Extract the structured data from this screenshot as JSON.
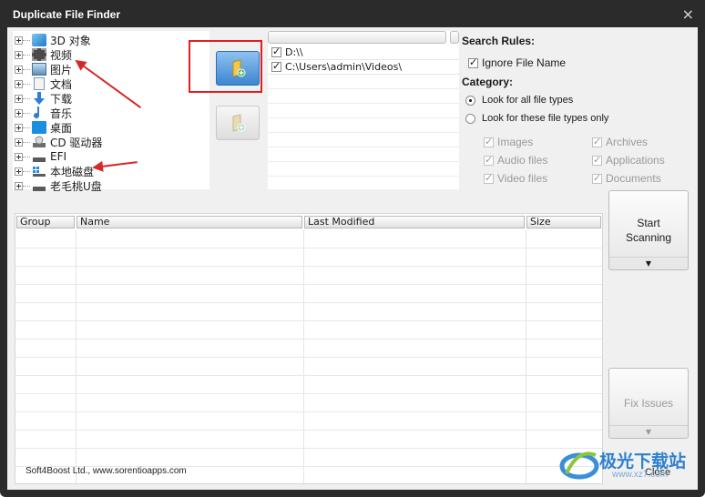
{
  "window": {
    "title": "Duplicate File Finder",
    "close_glyph": "×"
  },
  "tree": {
    "items": [
      {
        "label": "3D 对象",
        "icon": "3d-objects-icon"
      },
      {
        "label": "视频",
        "icon": "video-icon"
      },
      {
        "label": "图片",
        "icon": "pictures-icon"
      },
      {
        "label": "文档",
        "icon": "documents-icon"
      },
      {
        "label": "下载",
        "icon": "download-icon"
      },
      {
        "label": "音乐",
        "icon": "music-icon"
      },
      {
        "label": "桌面",
        "icon": "desktop-icon"
      },
      {
        "label": "CD 驱动器",
        "icon": "cd-drive-icon"
      },
      {
        "label": "EFI",
        "icon": "drive-icon"
      },
      {
        "label": "本地磁盘",
        "icon": "local-disk-icon"
      },
      {
        "label": "老毛桃U盘",
        "icon": "usb-drive-icon"
      }
    ]
  },
  "paths": {
    "items": [
      {
        "label": "D:\\\\",
        "checked": true
      },
      {
        "label": "C:\\Users\\admin\\Videos\\",
        "checked": true
      }
    ]
  },
  "search_rules": {
    "title": "Search Rules:",
    "ignore_file_name": {
      "label": "Ignore File Name",
      "checked": true
    },
    "category_title": "Category:",
    "look_all": "Look for all file types",
    "look_these": "Look for these file types only",
    "types": [
      {
        "label": "Images",
        "checked": true
      },
      {
        "label": "Archives",
        "checked": true
      },
      {
        "label": "Audio files",
        "checked": true
      },
      {
        "label": "Applications",
        "checked": true
      },
      {
        "label": "Video files",
        "checked": true
      },
      {
        "label": "Documents",
        "checked": true
      }
    ]
  },
  "results_table": {
    "columns": [
      "Group",
      "Name",
      "Last Modified",
      "Size"
    ]
  },
  "buttons": {
    "start_line1": "Start",
    "start_line2": "Scanning",
    "fix_issues": "Fix Issues",
    "dropdown_glyph": "▼"
  },
  "footer": {
    "company": "Soft4Boost Ltd., www.sorentioapps.com",
    "close_label": "Close"
  },
  "watermark": {
    "text": "极光下载站",
    "url": "www.xz7.com"
  },
  "colors": {
    "annotation_red": "#d62828",
    "title_bar": "#2b2b2b",
    "accent_blue": "#3c86d0"
  }
}
